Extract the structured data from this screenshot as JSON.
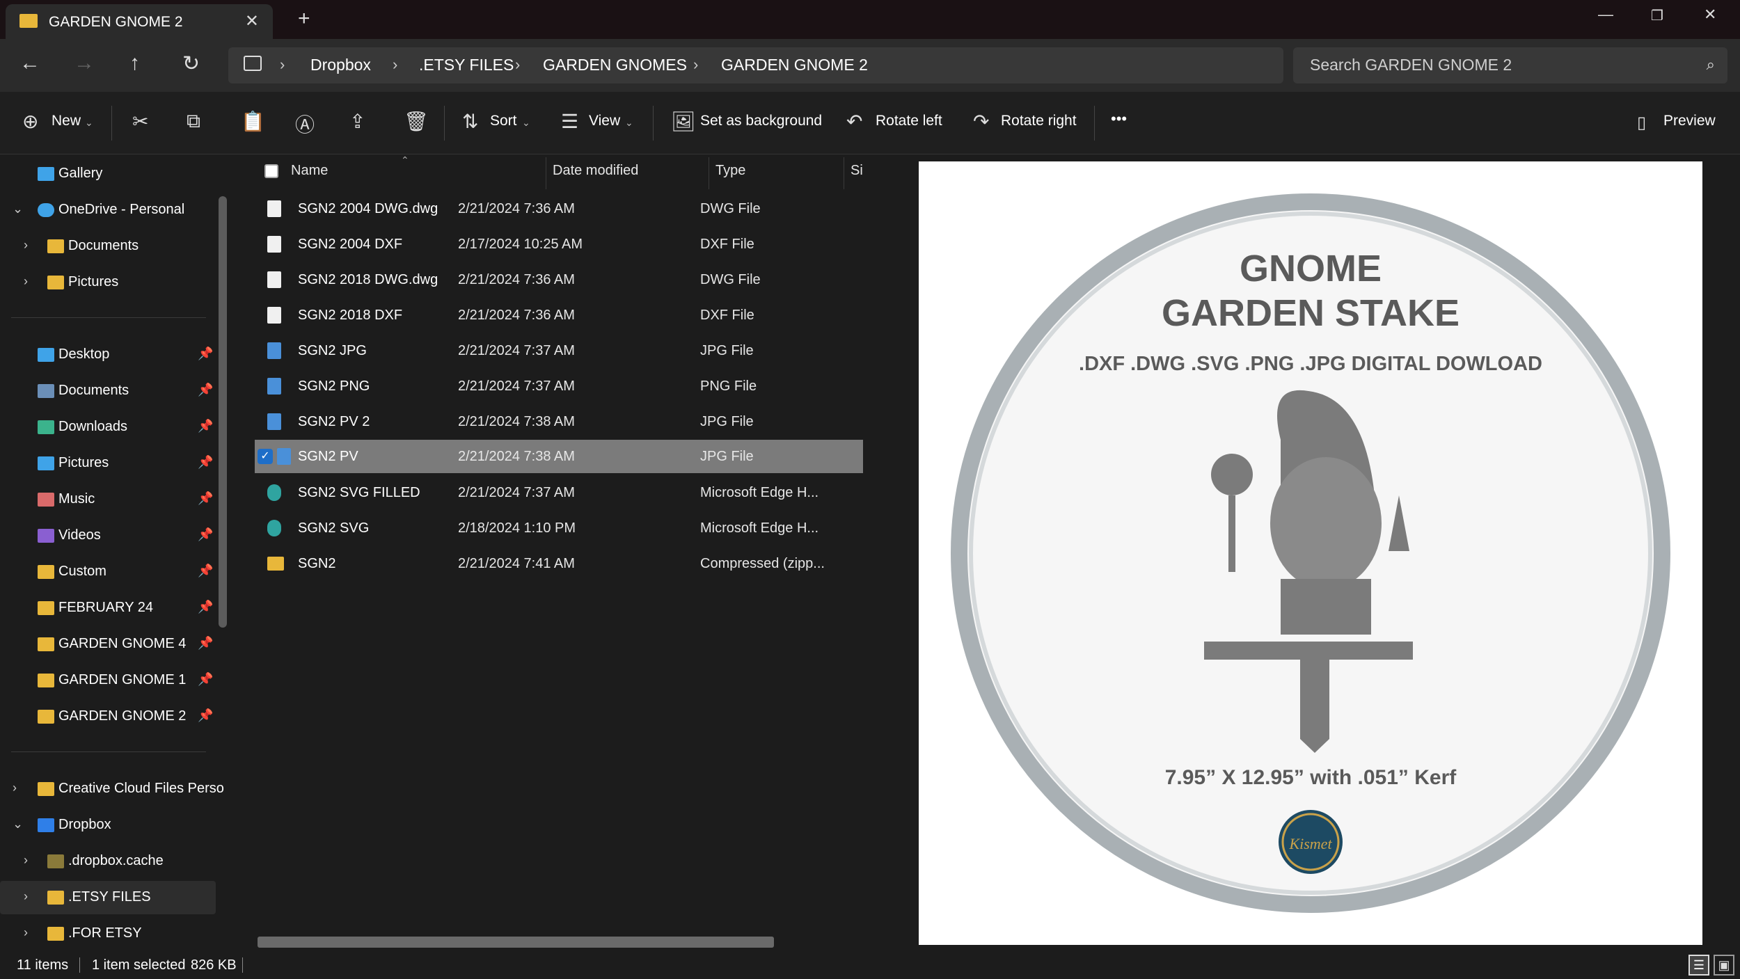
{
  "window": {
    "tab_title": "GARDEN GNOME 2",
    "tab_icon": "folder-icon"
  },
  "nav": {
    "breadcrumb": [
      "Dropbox",
      ".ETSY FILES",
      "GARDEN GNOMES",
      "GARDEN GNOME 2"
    ],
    "search_placeholder": "Search GARDEN GNOME 2"
  },
  "toolbar": {
    "new_label": "New",
    "sort_label": "Sort",
    "view_label": "View",
    "set_bg_label": "Set as background",
    "rotate_left_label": "Rotate left",
    "rotate_right_label": "Rotate right",
    "more_label": "•••",
    "preview_label": "Preview"
  },
  "sidebar": {
    "gallery": "Gallery",
    "onedrive": "OneDrive - Personal",
    "od_documents": "Documents",
    "od_pictures": "Pictures",
    "pinned": [
      {
        "label": "Desktop"
      },
      {
        "label": "Documents"
      },
      {
        "label": "Downloads"
      },
      {
        "label": "Pictures"
      },
      {
        "label": "Music"
      },
      {
        "label": "Videos"
      },
      {
        "label": "Custom"
      },
      {
        "label": "FEBRUARY 24"
      },
      {
        "label": "GARDEN GNOME 4"
      },
      {
        "label": "GARDEN GNOME 1"
      },
      {
        "label": "GARDEN GNOME 2"
      }
    ],
    "creative_cloud": "Creative Cloud Files Perso",
    "dropbox": "Dropbox",
    "dropbox_cache": ".dropbox.cache",
    "etsy_files": ".ETSY FILES",
    "for_etsy": ".FOR ETSY"
  },
  "list": {
    "headers": {
      "name": "Name",
      "date": "Date modified",
      "type": "Type",
      "size": "Si"
    },
    "files": [
      {
        "name": "SGN2 2004 DWG.dwg",
        "date": "2/21/2024 7:36 AM",
        "type": "DWG File"
      },
      {
        "name": "SGN2 2004 DXF",
        "date": "2/17/2024 10:25 AM",
        "type": "DXF File"
      },
      {
        "name": "SGN2 2018 DWG.dwg",
        "date": "2/21/2024 7:36 AM",
        "type": "DWG File"
      },
      {
        "name": "SGN2 2018 DXF",
        "date": "2/21/2024 7:36 AM",
        "type": "DXF File"
      },
      {
        "name": "SGN2 JPG",
        "date": "2/21/2024 7:37 AM",
        "type": "JPG File"
      },
      {
        "name": "SGN2 PNG",
        "date": "2/21/2024 7:37 AM",
        "type": "PNG File"
      },
      {
        "name": "SGN2 PV 2",
        "date": "2/21/2024 7:38 AM",
        "type": "JPG File"
      },
      {
        "name": "SGN2 PV",
        "date": "2/21/2024 7:38 AM",
        "type": "JPG File"
      },
      {
        "name": "SGN2 SVG FILLED",
        "date": "2/21/2024 7:37 AM",
        "type": "Microsoft Edge H..."
      },
      {
        "name": "SGN2 SVG",
        "date": "2/18/2024 1:10 PM",
        "type": "Microsoft Edge H..."
      },
      {
        "name": "SGN2",
        "date": "2/21/2024 7:41 AM",
        "type": "Compressed (zipp..."
      }
    ]
  },
  "preview": {
    "title_line1": "GNOME",
    "title_line2": "GARDEN STAKE",
    "formats": ".DXF .DWG .SVG .PNG .JPG DIGITAL DOWLOAD",
    "dimensions": "7.95” X 12.95” with .051” Kerf",
    "logo_text": "Kismet"
  },
  "status": {
    "count": "11 items",
    "selected": "1 item selected",
    "size": "826 KB"
  },
  "colors": {
    "accent": "#1e6ec8",
    "folder": "#e8b73a",
    "selected_row": "#7b7b7b"
  }
}
